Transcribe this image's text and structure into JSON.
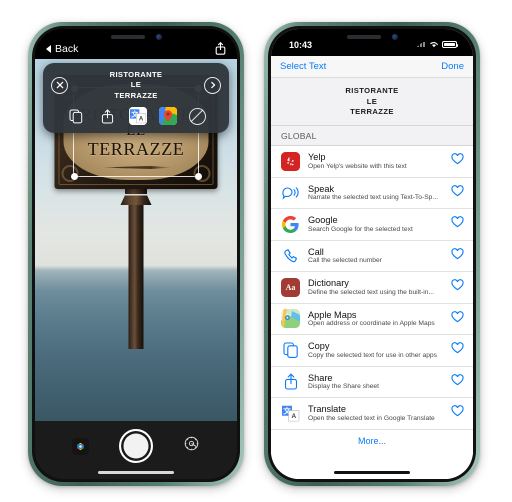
{
  "left_phone": {
    "topbar": {
      "back_label": "Back",
      "share_icon": "share-icon"
    },
    "ocr_popup": {
      "close_icon": "close-circle-icon",
      "next_icon": "chevron-right-circle-icon",
      "detected_text_line1": "RISTORANTE",
      "detected_text_line2": "LE",
      "detected_text_line3": "TERRAZZE",
      "actions": [
        {
          "name": "copy-icon",
          "label": "Copy"
        },
        {
          "name": "share-icon",
          "label": "Share"
        },
        {
          "name": "google-translate-icon",
          "label": "Translate"
        },
        {
          "name": "google-maps-icon",
          "label": "Maps"
        },
        {
          "name": "no-action-icon",
          "label": "Dismiss"
        }
      ]
    },
    "sign": {
      "line1": "RISTORANTE",
      "line2": "LE",
      "line3": "TERRAZZE"
    },
    "camera_bar": {
      "photos_icon": "photos-library-icon",
      "shutter_icon": "shutter-button",
      "settings_icon": "settings-gear-icon"
    }
  },
  "right_phone": {
    "status_bar": {
      "time": "10:43",
      "signal_icon": "cellular-signal-icon",
      "wifi_icon": "wifi-icon",
      "battery_icon": "battery-icon"
    },
    "nav_bar": {
      "left_label": "Select Text",
      "right_label": "Done"
    },
    "selected_text": {
      "line1": "RISTORANTE",
      "line2": "LE",
      "line3": "TERRAZZE"
    },
    "section_header": "GLOBAL",
    "actions": [
      {
        "icon": "yelp-icon",
        "title": "Yelp",
        "subtitle": "Open Yelp's website with this text",
        "favorite_icon": "heart-outline-icon"
      },
      {
        "icon": "speak-icon",
        "title": "Speak",
        "subtitle": "Narrate the selected text using Text-To-Sp...",
        "favorite_icon": "heart-outline-icon"
      },
      {
        "icon": "google-icon",
        "title": "Google",
        "subtitle": "Search Google for the selected text",
        "favorite_icon": "heart-outline-icon"
      },
      {
        "icon": "phone-icon",
        "title": "Call",
        "subtitle": "Call the selected number",
        "favorite_icon": "heart-outline-icon"
      },
      {
        "icon": "dictionary-icon",
        "title": "Dictionary",
        "subtitle": "Define the selected text using the built-in...",
        "favorite_icon": "heart-outline-icon"
      },
      {
        "icon": "apple-maps-icon",
        "title": "Apple Maps",
        "subtitle": "Open address or coordinate in Apple Maps",
        "favorite_icon": "heart-outline-icon"
      },
      {
        "icon": "copy-icon",
        "title": "Copy",
        "subtitle": "Copy the selected text for use in other apps",
        "favorite_icon": "heart-outline-icon"
      },
      {
        "icon": "share-icon",
        "title": "Share",
        "subtitle": "Display the Share sheet",
        "favorite_icon": "heart-outline-icon"
      },
      {
        "icon": "google-translate-icon",
        "title": "Translate",
        "subtitle": "Open the selected text in Google Translate",
        "favorite_icon": "heart-outline-icon"
      }
    ],
    "more_label": "More..."
  },
  "colors": {
    "accent_blue": "#0a7bf5",
    "phone_frame_green": "#4e7566",
    "yelp_red": "#d32323",
    "dictionary_red": "#a33b35"
  }
}
